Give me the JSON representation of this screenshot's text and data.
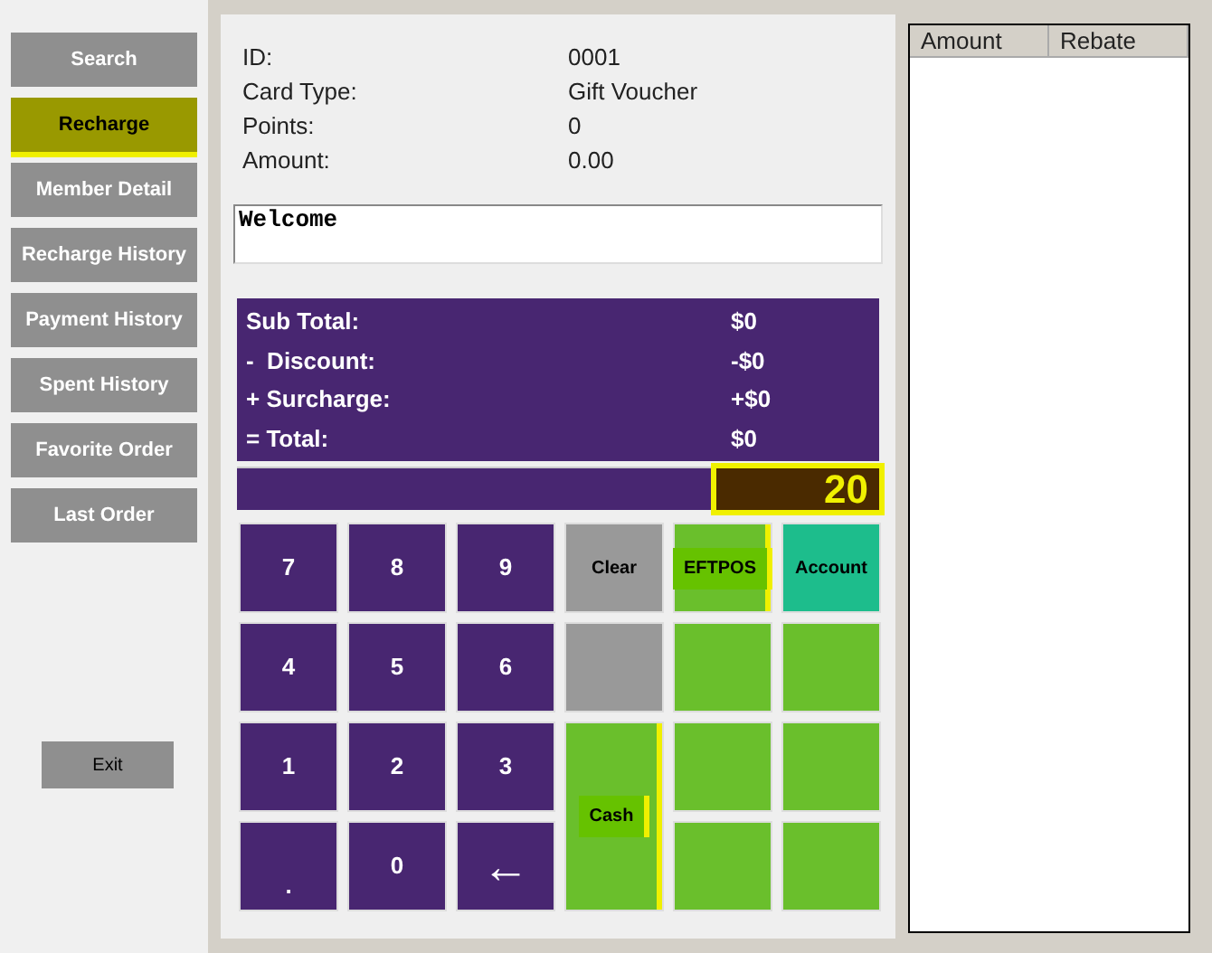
{
  "sidebar": {
    "items": [
      {
        "label": "Search",
        "highlighted": false
      },
      {
        "label": "Recharge",
        "highlighted": true
      },
      {
        "label": "Member Detail",
        "highlighted": false
      },
      {
        "label": "Recharge History",
        "highlighted": false
      },
      {
        "label": "Payment History",
        "highlighted": false
      },
      {
        "label": "Spent History",
        "highlighted": false
      },
      {
        "label": "Favorite Order",
        "highlighted": false
      },
      {
        "label": "Last Order",
        "highlighted": false
      }
    ],
    "exit_button": "Exit"
  },
  "member_info": [
    {
      "label": "ID:",
      "value": "0001"
    },
    {
      "label": "Card Type:",
      "value": "Gift Voucher"
    },
    {
      "label": "Points:",
      "value": "0"
    },
    {
      "label": "Amount:",
      "value": "0.00"
    }
  ],
  "message_box": {
    "value": "Welcome"
  },
  "totals": [
    {
      "label": "Sub Total:",
      "value": "$0"
    },
    {
      "label": "-  Discount:",
      "value": "-$0"
    },
    {
      "label": "+ Surcharge:",
      "value": "+$0"
    },
    {
      "label": "= Total:",
      "value": "$0"
    }
  ],
  "entry_display": {
    "value": "20",
    "highlighted": true
  },
  "keypad": [
    {
      "label": "7",
      "color": "#482671",
      "tall": false,
      "highlighted": false
    },
    {
      "label": "8",
      "color": "#482671",
      "tall": false,
      "highlighted": false
    },
    {
      "label": "9",
      "color": "#482671",
      "tall": false,
      "highlighted": false
    },
    {
      "label": "Clear",
      "color": "#999999",
      "tall": false,
      "highlighted": false
    },
    {
      "label": "EFTPOS",
      "color": "#6abf2c",
      "tall": false,
      "highlighted": true
    },
    {
      "label": "Account",
      "color": "#1dbd8c",
      "tall": false,
      "highlighted": false
    },
    {
      "label": "4",
      "color": "#482671",
      "tall": false,
      "highlighted": false
    },
    {
      "label": "5",
      "color": "#482671",
      "tall": false,
      "highlighted": false
    },
    {
      "label": "6",
      "color": "#482671",
      "tall": false,
      "highlighted": false
    },
    {
      "color": "#999999",
      "tall": false,
      "highlighted": false
    },
    {
      "color": "#6abf2c",
      "tall": false,
      "highlighted": false
    },
    {
      "color": "#6abf2c",
      "tall": false,
      "highlighted": false
    },
    {
      "label": "1",
      "color": "#482671",
      "tall": false,
      "highlighted": false
    },
    {
      "label": "2",
      "color": "#482671",
      "tall": false,
      "highlighted": false
    },
    {
      "label": "3",
      "color": "#482671",
      "tall": false,
      "highlighted": false
    },
    {
      "label": "Cash",
      "color": "#6abf2c",
      "tall": true,
      "highlighted": true
    },
    {
      "color": "#6abf2c",
      "tall": false,
      "highlighted": false
    },
    {
      "color": "#6abf2c",
      "tall": false,
      "highlighted": false
    },
    {
      "label": ".",
      "color": "#482671",
      "tall": false,
      "highlighted": false
    },
    {
      "label": "0",
      "color": "#482671",
      "tall": false,
      "highlighted": false
    },
    {
      "label": "←",
      "color": "#482671",
      "tall": false,
      "highlighted": false
    },
    {
      "color": "#6abf2c",
      "tall": false,
      "highlighted": false
    },
    {
      "color": "#6abf2c",
      "tall": false,
      "highlighted": false
    }
  ],
  "table": {
    "columns": [
      "Amount",
      "Rebate"
    ]
  }
}
